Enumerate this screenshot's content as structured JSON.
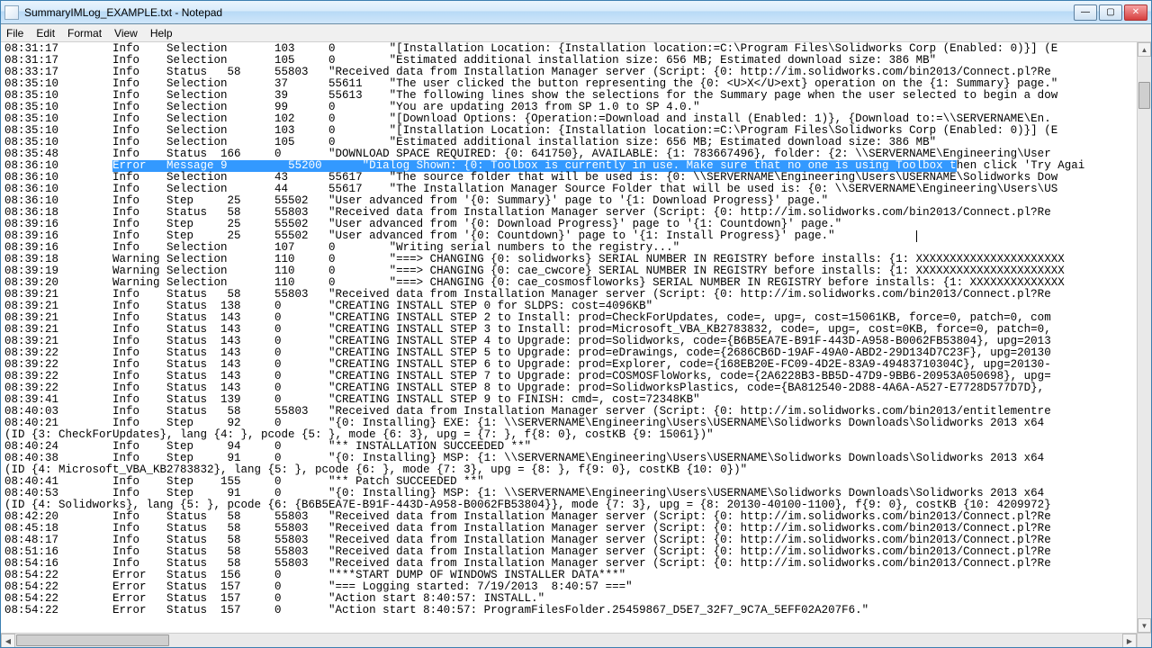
{
  "window": {
    "title": "SummaryIMLog_EXAMPLE.txt - Notepad"
  },
  "menu": {
    "file": "File",
    "edit": "Edit",
    "format": "Format",
    "view": "View",
    "help": "Help"
  },
  "selection": {
    "row_index": 10,
    "selected_text": "Error   Message 9         55200      \"Dialog Shown: {0: Toolbox is currently in use. Make sure that no one is using Toolbox t",
    "tail_text": "hen click 'Try Agai"
  },
  "caret_row_index": 16,
  "lines": [
    "08:31:17        Info    Selection       103     0        \"[Installation Location: {Installation location:=C:\\Program Files\\Solidworks Corp (Enabled: 0)}] (E",
    "08:31:17        Info    Selection       105     0        \"Estimated additional installation size: 656 MB; Estimated download size: 386 MB\"",
    "08:33:17        Info    Status   58     55803   \"Received data from Installation Manager server (Script: {0: http://im.solidworks.com/bin2013/Connect.pl?Re",
    "08:35:10        Info    Selection       37      55611    \"The user clicked the button representing the {0: <U>X</U>ext} operation on the {1: Summary} page.\"",
    "08:35:10        Info    Selection       39      55613    \"The following lines show the selections for the Summary page when the user selected to begin a dow",
    "08:35:10        Info    Selection       99      0        \"You are updating 2013 from SP 1.0 to SP 4.0.\"",
    "08:35:10        Info    Selection       102     0        \"[Download Options: {Operation:=Download and install (Enabled: 1)}, {Download to:=\\\\SERVERNAME\\En.",
    "08:35:10        Info    Selection       103     0        \"[Installation Location: {Installation location:=C:\\Program Files\\Solidworks Corp (Enabled: 0)}] (E",
    "08:35:10        Info    Selection       105     0        \"Estimated additional installation size: 656 MB; Estimated download size: 386 MB\"",
    "08:35:48        Info    Status  166     0       \"DOWNLOAD SPACE REQUIRED: {0: 641750}, AVAILABLE: {1: 783667496}, folder: {2: \\\\SERVERNAME\\Engineering\\User",
    "08:36:10        ",
    "08:36:10        Info    Selection       43      55617    \"The source folder that will be used is: {0: \\\\SERVERNAME\\Engineering\\Users\\USERNAME\\Solidworks Dow",
    "08:36:10        Info    Selection       44      55617    \"The Installation Manager Source Folder that will be used is: {0: \\\\SERVERNAME\\Engineering\\Users\\US",
    "08:36:10        Info    Step     25     55502   \"User advanced from '{0: Summary}' page to '{1: Download Progress}' page.\"",
    "08:36:18        Info    Status   58     55803   \"Received data from Installation Manager server (Script: {0: http://im.solidworks.com/bin2013/Connect.pl?Re",
    "08:39:16        Info    Step     25     55502   \"User advanced from '{0: Download Progress}' page to '{1: Countdown}' page.\"",
    "08:39:16        Info    Step     25     55502   \"User advanced from '{0: Countdown}' page to '{1: Install Progress}' page.\"",
    "08:39:16        Info    Selection       107     0        \"Writing serial numbers to the registry...\"",
    "08:39:18        Warning Selection       110     0        \"===> CHANGING {0: solidworks} SERIAL NUMBER IN REGISTRY before installs: {1: XXXXXXXXXXXXXXXXXXXXXX",
    "08:39:19        Warning Selection       110     0        \"===> CHANGING {0: cae_cwcore} SERIAL NUMBER IN REGISTRY before installs: {1: XXXXXXXXXXXXXXXXXXXXXX",
    "08:39:20        Warning Selection       110     0        \"===> CHANGING {0: cae_cosmosfloworks} SERIAL NUMBER IN REGISTRY before installs: {1: XXXXXXXXXXXXXX",
    "08:39:21        Info    Status   58     55803   \"Received data from Installation Manager server (Script: {0: http://im.solidworks.com/bin2013/Connect.pl?Re",
    "08:39:21        Info    Status  138     0       \"CREATING INSTALL STEP 0 for SLDPS: cost=4096KB\"",
    "08:39:21        Info    Status  143     0       \"CREATING INSTALL STEP 2 to Install: prod=CheckForUpdates, code=, upg=, cost=15061KB, force=0, patch=0, com",
    "08:39:21        Info    Status  143     0       \"CREATING INSTALL STEP 3 to Install: prod=Microsoft_VBA_KB2783832, code=, upg=, cost=0KB, force=0, patch=0,",
    "08:39:21        Info    Status  143     0       \"CREATING INSTALL STEP 4 to Upgrade: prod=Solidworks, code={B6B5EA7E-B91F-443D-A958-B0062FB53804}, upg=2013",
    "08:39:22        Info    Status  143     0       \"CREATING INSTALL STEP 5 to Upgrade: prod=eDrawings, code={2686CB6D-19AF-49A0-ABD2-29D134D7C23F}, upg=20130",
    "08:39:22        Info    Status  143     0       \"CREATING INSTALL STEP 6 to Upgrade: prod=Explorer, code={168EB20E-FC09-4D2E-83A9-49483710304C}, upg=20130-",
    "08:39:22        Info    Status  143     0       \"CREATING INSTALL STEP 7 to Upgrade: prod=COSMOSFloWorks, code={2A6228B3-BB5D-47D9-9BB6-20953A050698}, upg=",
    "08:39:22        Info    Status  143     0       \"CREATING INSTALL STEP 8 to Upgrade: prod=SolidworksPlastics, code={BA812540-2D88-4A6A-A527-E7728D577D7D},",
    "08:39:41        Info    Status  139     0       \"CREATING INSTALL STEP 9 to FINISH: cmd=, cost=72348KB\"",
    "08:40:03        Info    Status   58     55803   \"Received data from Installation Manager server (Script: {0: http://im.solidworks.com/bin2013/entitlementre",
    "08:40:21        Info    Step     92     0       \"{0: Installing} EXE: {1: \\\\SERVERNAME\\Engineering\\Users\\USERNAME\\Solidworks Downloads\\Solidworks 2013 x64",
    "(ID {3: CheckForUpdates}, lang {4: }, pcode {5: }, mode {6: 3}, upg = {7: }, f{8: 0}, costKB {9: 15061})\"",
    "08:40:24        Info    Step     94     0       \"** INSTALLATION SUCCEEDED **\"",
    "08:40:38        Info    Step     91     0       \"{0: Installing} MSP: {1: \\\\SERVERNAME\\Engineering\\Users\\USERNAME\\Solidworks Downloads\\Solidworks 2013 x64",
    "(ID {4: Microsoft_VBA_KB2783832}, lang {5: }, pcode {6: }, mode {7: 3}, upg = {8: }, f{9: 0}, costKB {10: 0})\"",
    "08:40:41        Info    Step    155     0       \"** Patch SUCCEEDED **\"",
    "08:40:53        Info    Step     91     0       \"{0: Installing} MSP: {1: \\\\SERVERNAME\\Engineering\\Users\\USERNAME\\Solidworks Downloads\\Solidworks 2013 x64",
    "(ID {4: Solidworks}, lang {5: }, pcode {6: {B6B5EA7E-B91F-443D-A958-B0062FB53804}}, mode {7: 3}, upg = {8: 20130-40100-1100}, f{9: 0}, costKB {10: 4209972}",
    "08:42:20        Info    Status   58     55803   \"Received data from Installation Manager server (Script: {0: http://im.solidworks.com/bin2013/Connect.pl?Re",
    "08:45:18        Info    Status   58     55803   \"Received data from Installation Manager server (Script: {0: http://im.solidworks.com/bin2013/Connect.pl?Re",
    "08:48:17        Info    Status   58     55803   \"Received data from Installation Manager server (Script: {0: http://im.solidworks.com/bin2013/Connect.pl?Re",
    "08:51:16        Info    Status   58     55803   \"Received data from Installation Manager server (Script: {0: http://im.solidworks.com/bin2013/Connect.pl?Re",
    "08:54:16        Info    Status   58     55803   \"Received data from Installation Manager server (Script: {0: http://im.solidworks.com/bin2013/Connect.pl?Re",
    "08:54:22        Error   Status  156     0       \"***START DUMP OF WINDOWS INSTALLER DATA***\"",
    "08:54:22        Error   Status  157     0       \"=== Logging started: 7/19/2013  8:40:57 ===\"",
    "08:54:22        Error   Status  157     0       \"Action start 8:40:57: INSTALL.\"",
    "08:54:22        Error   Status  157     0       \"Action start 8:40:57: ProgramFilesFolder.25459867_D5E7_32F7_9C7A_5EFF02A207F6.\""
  ]
}
